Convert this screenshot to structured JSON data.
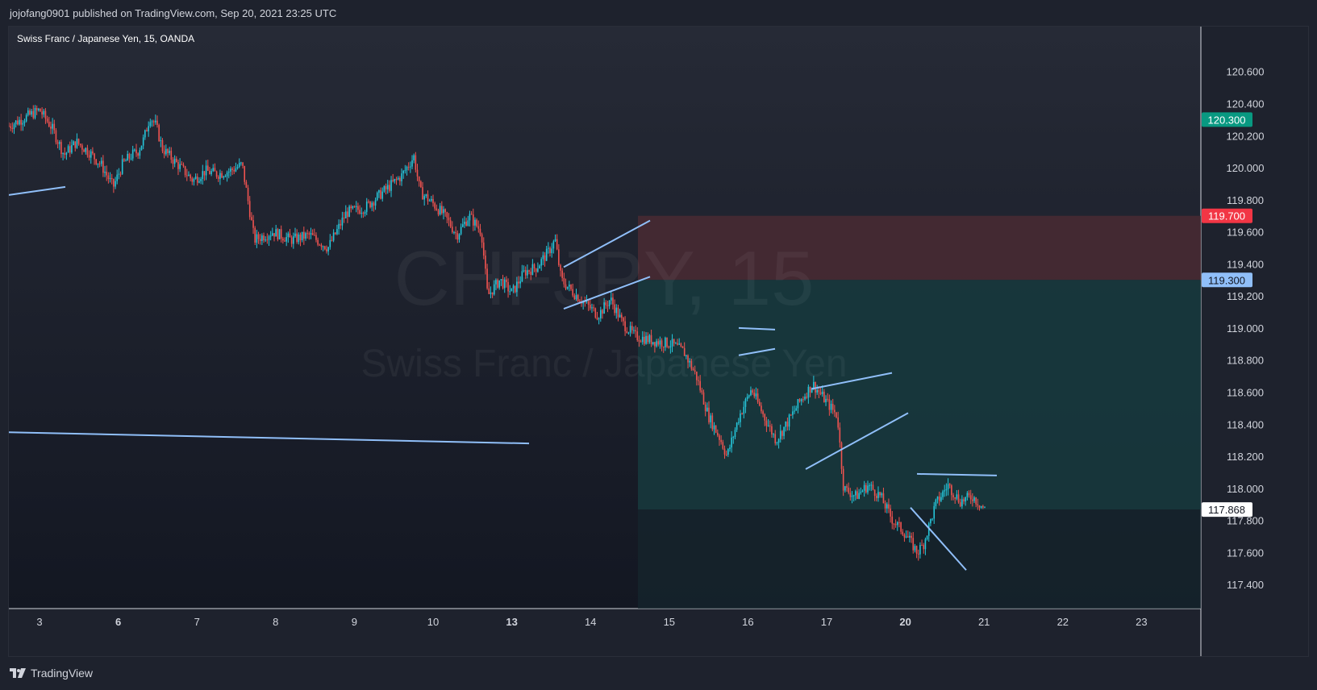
{
  "header": {
    "published_text": "jojofang0901 published on TradingView.com, Sep 20, 2021 23:25 UTC"
  },
  "chart_title": "Swiss Franc / Japanese Yen, 15, OANDA",
  "watermark": {
    "symbol": "CHFJPY, 15",
    "name": "Swiss Franc / Japanese Yen"
  },
  "footer": {
    "logo_text": "TradingView",
    "logo_icon": "tradingview-logo-icon"
  },
  "colors": {
    "background_top": "#262a36",
    "background_bottom": "#131722",
    "candle_up": "#26c6da",
    "candle_down": "#ef5350",
    "drawing_line": "#90bff9",
    "stop_zone": "#4a2a33",
    "target_zone": "#17393d",
    "stop_label": "#f23645",
    "entry_label": "#90bff9",
    "target_label": "#089981",
    "last_price_label": "#ffffff"
  },
  "chart_data": {
    "type": "candlestick",
    "symbol": "CHFJPY",
    "interval": "15",
    "source": "OANDA",
    "y_axis": {
      "ticks": [
        "120.600",
        "120.400",
        "120.200",
        "120.000",
        "119.800",
        "119.600",
        "119.400",
        "119.200",
        "119.000",
        "118.800",
        "118.600",
        "118.400",
        "118.200",
        "118.000",
        "117.800",
        "117.600",
        "117.400"
      ],
      "range": [
        117.25,
        120.88
      ]
    },
    "x_axis": {
      "ticks": [
        {
          "label": "3",
          "bold": false
        },
        {
          "label": "6",
          "bold": true
        },
        {
          "label": "7",
          "bold": false
        },
        {
          "label": "8",
          "bold": false
        },
        {
          "label": "9",
          "bold": false
        },
        {
          "label": "10",
          "bold": false
        },
        {
          "label": "13",
          "bold": true
        },
        {
          "label": "14",
          "bold": false
        },
        {
          "label": "15",
          "bold": false
        },
        {
          "label": "16",
          "bold": false
        },
        {
          "label": "17",
          "bold": false
        },
        {
          "label": "20",
          "bold": true
        },
        {
          "label": "21",
          "bold": false
        },
        {
          "label": "22",
          "bold": false
        },
        {
          "label": "23",
          "bold": false
        }
      ]
    },
    "price_path": [
      [
        3,
        120.26
      ],
      [
        3.3,
        120.32
      ],
      [
        3.5,
        120.36
      ],
      [
        3.7,
        120.25
      ],
      [
        3.9,
        120.08
      ],
      [
        4.1,
        120.16
      ],
      [
        4.3,
        120.1
      ],
      [
        4.5,
        120.02
      ],
      [
        4.7,
        119.88
      ],
      [
        4.85,
        120.02
      ],
      [
        5.0,
        120.08
      ],
      [
        5.1,
        120.1
      ],
      [
        5.2,
        120.18
      ],
      [
        5.3,
        120.32
      ],
      [
        5.4,
        120.26
      ],
      [
        5.5,
        120.12
      ],
      [
        6.0,
        119.92
      ],
      [
        6.2,
        119.98
      ],
      [
        6.4,
        119.96
      ],
      [
        6.6,
        119.98
      ],
      [
        6.8,
        120.02
      ],
      [
        7.0,
        119.55
      ],
      [
        7.3,
        119.6
      ],
      [
        7.6,
        119.55
      ],
      [
        7.9,
        119.58
      ],
      [
        8.2,
        119.5
      ],
      [
        8.5,
        119.72
      ],
      [
        8.8,
        119.75
      ],
      [
        9.1,
        119.85
      ],
      [
        9.4,
        119.95
      ],
      [
        9.6,
        120.07
      ],
      [
        9.7,
        119.85
      ],
      [
        9.9,
        119.78
      ],
      [
        10.1,
        119.7
      ],
      [
        10.3,
        119.58
      ],
      [
        10.5,
        119.7
      ],
      [
        10.7,
        119.6
      ],
      [
        10.8,
        119.2
      ],
      [
        11.0,
        119.3
      ],
      [
        11.2,
        119.22
      ],
      [
        11.4,
        119.35
      ],
      [
        11.6,
        119.38
      ],
      [
        11.8,
        119.48
      ],
      [
        11.9,
        119.55
      ],
      [
        12.0,
        119.3
      ],
      [
        12.2,
        119.22
      ],
      [
        12.4,
        119.15
      ],
      [
        12.6,
        119.08
      ],
      [
        12.8,
        119.18
      ],
      [
        13.0,
        119.03
      ],
      [
        13.2,
        118.95
      ],
      [
        13.5,
        118.92
      ],
      [
        13.8,
        118.9
      ],
      [
        14.0,
        118.85
      ],
      [
        14.2,
        118.7
      ],
      [
        14.4,
        118.45
      ],
      [
        14.6,
        118.3
      ],
      [
        14.7,
        118.2
      ],
      [
        14.9,
        118.45
      ],
      [
        15.1,
        118.62
      ],
      [
        15.3,
        118.45
      ],
      [
        15.5,
        118.3
      ],
      [
        15.7,
        118.42
      ],
      [
        15.9,
        118.55
      ],
      [
        16.1,
        118.65
      ],
      [
        16.3,
        118.55
      ],
      [
        16.5,
        118.45
      ],
      [
        16.6,
        118.0
      ],
      [
        16.8,
        117.95
      ],
      [
        17.0,
        118.02
      ],
      [
        17.2,
        117.95
      ],
      [
        17.4,
        117.8
      ],
      [
        17.6,
        117.72
      ],
      [
        17.8,
        117.6
      ],
      [
        17.9,
        117.65
      ],
      [
        18.1,
        117.9
      ],
      [
        18.3,
        118.02
      ],
      [
        18.5,
        117.92
      ],
      [
        18.7,
        117.95
      ],
      [
        18.9,
        117.87
      ]
    ],
    "drawings": [
      {
        "name": "trendline-left-short",
        "points": [
          [
            0,
            119.83
          ],
          [
            7,
            119.88
          ]
        ]
      },
      {
        "name": "trendline-long-horizontal",
        "points": [
          [
            0,
            118.35
          ],
          [
            64.5,
            118.28
          ]
        ]
      },
      {
        "name": "rising-wedge-upper",
        "points": [
          [
            68.8,
            119.38
          ],
          [
            79.5,
            119.67
          ]
        ]
      },
      {
        "name": "rising-wedge-lower",
        "points": [
          [
            68.8,
            119.12
          ],
          [
            79.5,
            119.32
          ]
        ]
      },
      {
        "name": "flag-upper",
        "points": [
          [
            90.5,
            119.0
          ],
          [
            95,
            118.99
          ]
        ]
      },
      {
        "name": "flag-lower",
        "points": [
          [
            90.5,
            118.83
          ],
          [
            95,
            118.87
          ]
        ]
      },
      {
        "name": "channel-upper",
        "points": [
          [
            99.5,
            118.62
          ],
          [
            109.5,
            118.72
          ]
        ]
      },
      {
        "name": "channel-lower",
        "points": [
          [
            98.8,
            118.12
          ],
          [
            111.5,
            118.47
          ]
        ]
      },
      {
        "name": "triangle-upper",
        "points": [
          [
            112.6,
            118.09
          ],
          [
            122.5,
            118.08
          ]
        ]
      },
      {
        "name": "triangle-lower",
        "points": [
          [
            111.8,
            117.88
          ],
          [
            118.7,
            117.49
          ]
        ]
      }
    ],
    "position_tool": {
      "entry": 119.3,
      "stop": 119.7,
      "target": 117.868
    },
    "price_labels": [
      {
        "value": "120.300",
        "kind": "target"
      },
      {
        "value": "119.700",
        "kind": "stop"
      },
      {
        "value": "119.300",
        "kind": "entry"
      },
      {
        "value": "117.868",
        "kind": "last"
      }
    ],
    "grid": false,
    "legend": "none"
  }
}
